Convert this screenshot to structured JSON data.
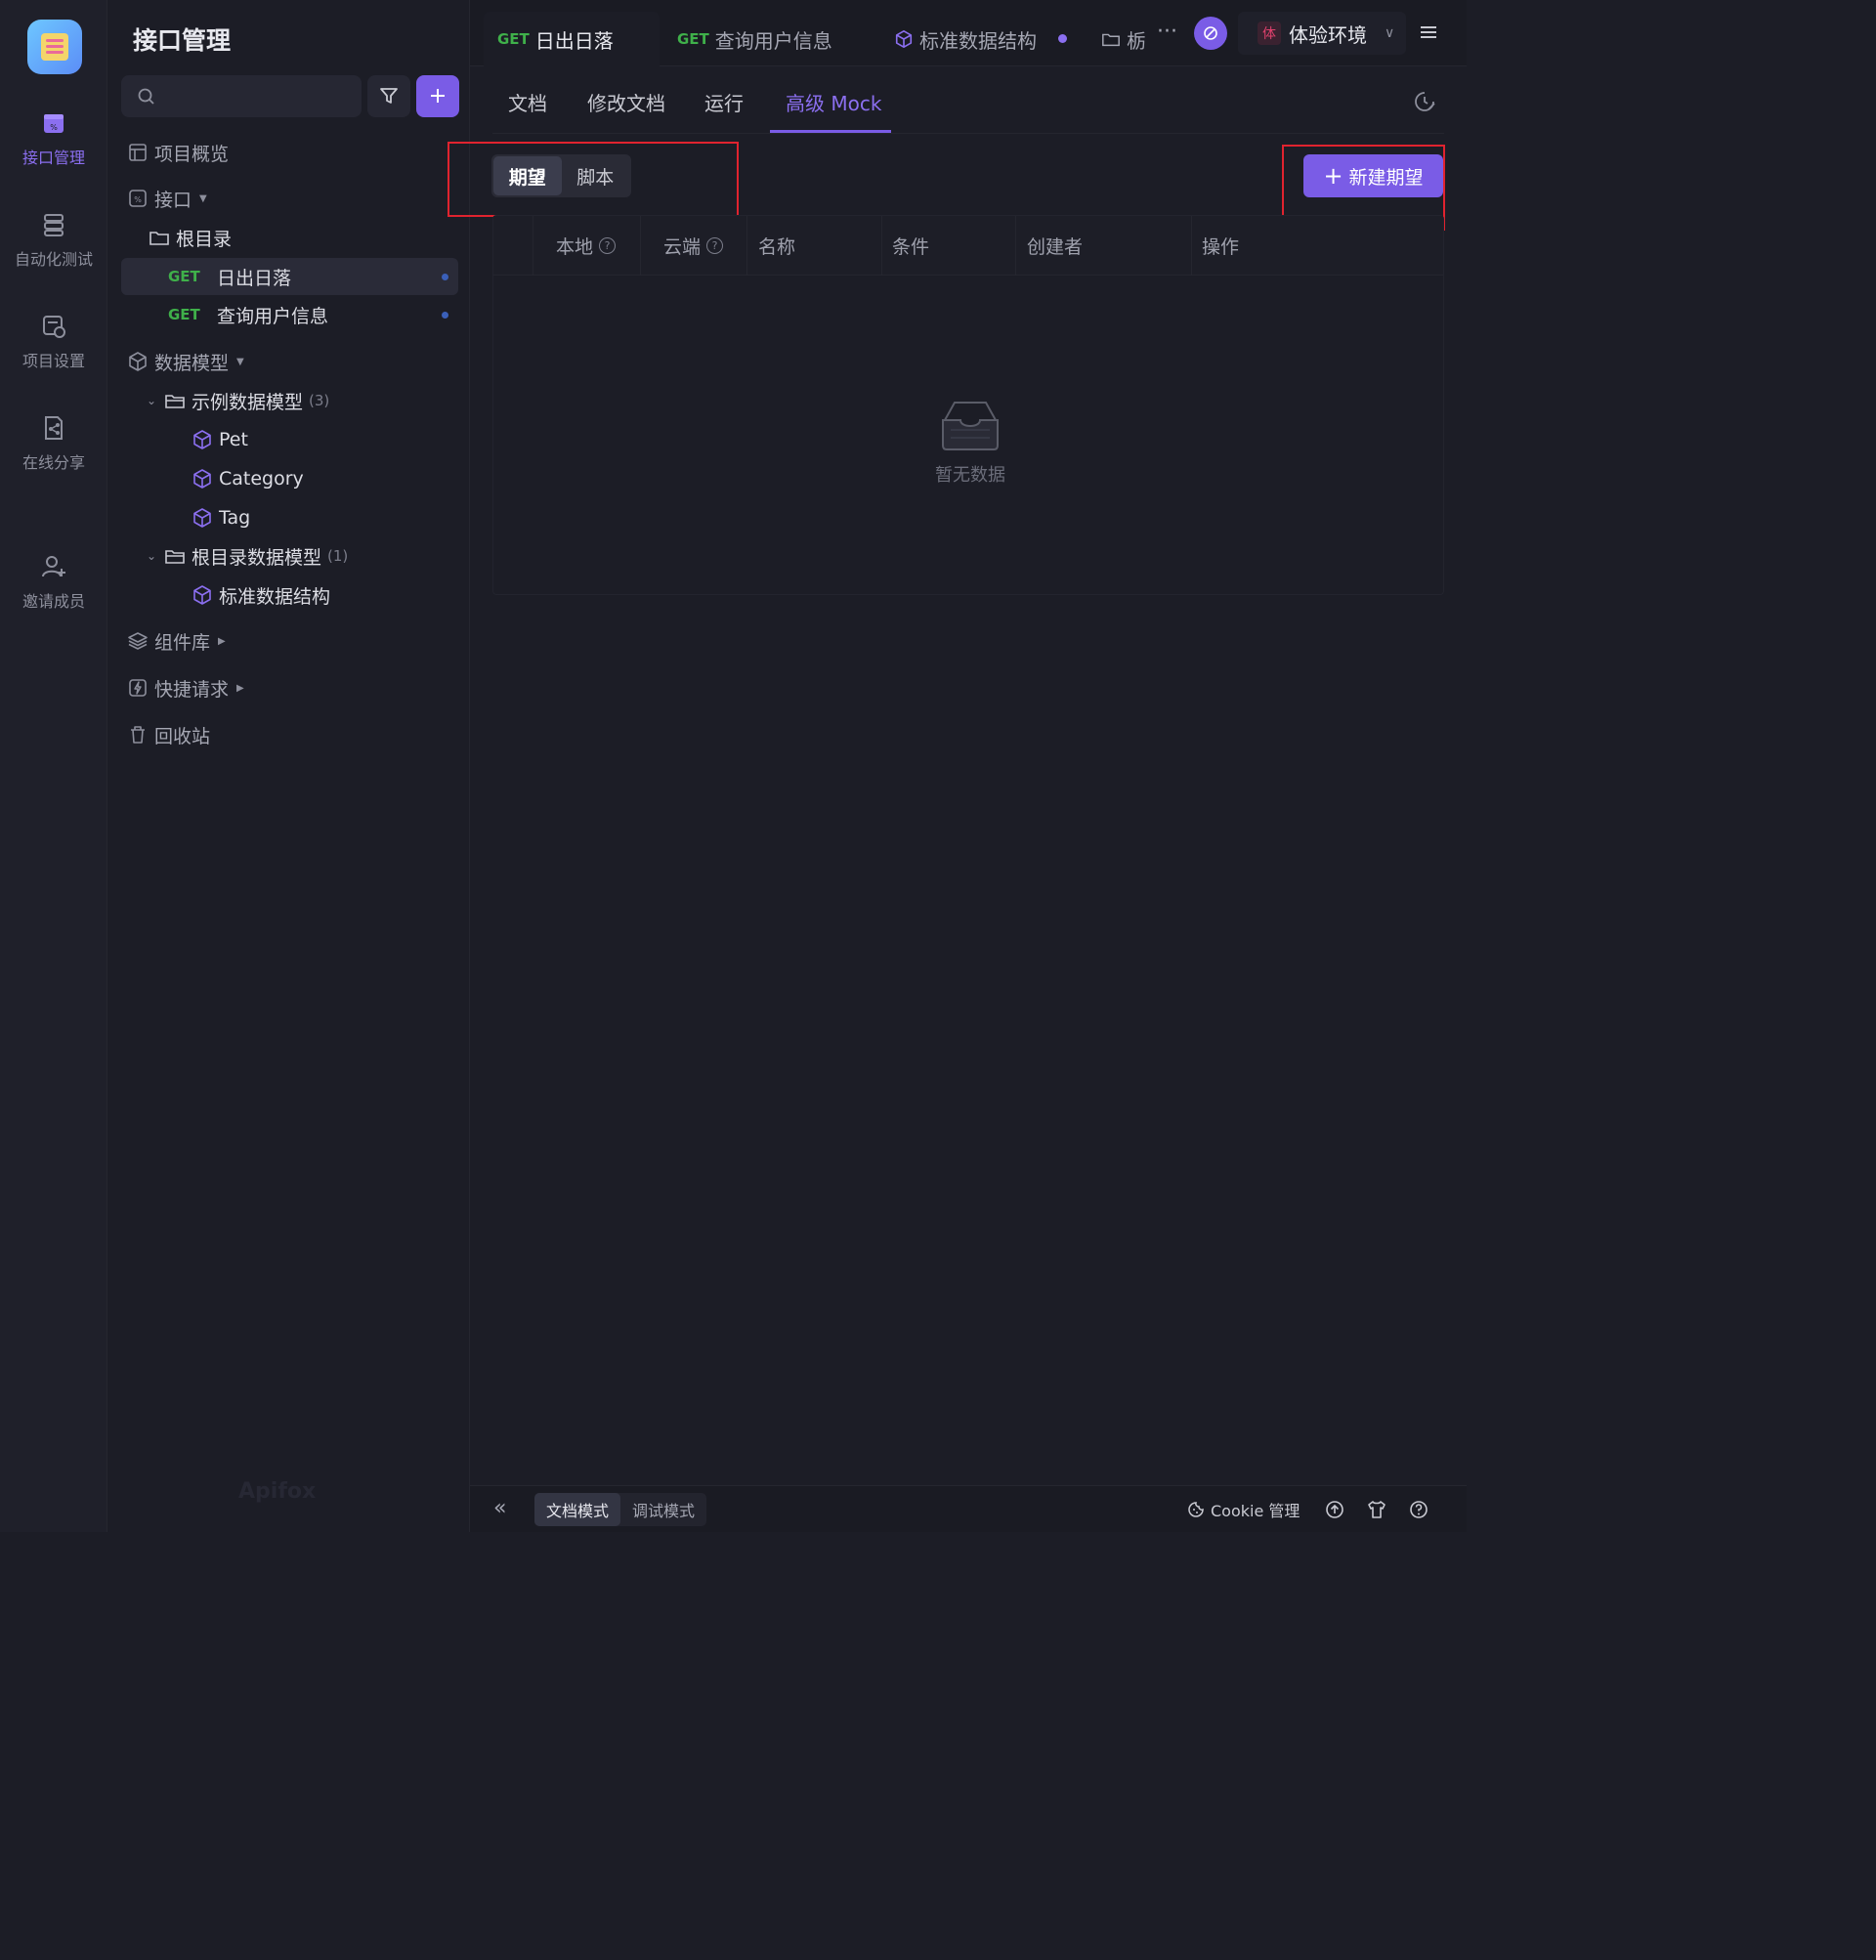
{
  "app": {
    "rail": [
      {
        "label": "接口管理",
        "icon": "api-icon",
        "active": true
      },
      {
        "label": "自动化测试",
        "icon": "database-icon",
        "active": false
      },
      {
        "label": "项目设置",
        "icon": "project-settings-icon",
        "active": false
      },
      {
        "label": "在线分享",
        "icon": "share-doc-icon",
        "active": false
      },
      {
        "label": "邀请成员",
        "icon": "invite-user-icon",
        "active": false
      }
    ],
    "watermark": "Apifox"
  },
  "sidebar": {
    "title": "接口管理",
    "search": {
      "value": "",
      "placeholder": ""
    },
    "tree": {
      "overview": "项目概览",
      "apis": "接口",
      "root": "根目录",
      "endpoints": [
        {
          "method": "GET",
          "name": "日出日落",
          "selected": true
        },
        {
          "method": "GET",
          "name": "查询用户信息",
          "selected": false
        }
      ],
      "models": "数据模型",
      "example_folder": {
        "name": "示例数据模型",
        "count": "(3)",
        "items": [
          "Pet",
          "Category",
          "Tag"
        ]
      },
      "root_folder": {
        "name": "根目录数据模型",
        "count": "(1)",
        "items": [
          "标准数据结构"
        ]
      },
      "components": "组件库",
      "quick": "快捷请求",
      "trash": "回收站"
    }
  },
  "tabs": [
    {
      "method": "GET",
      "name": "日出日落",
      "active": true
    },
    {
      "method": "GET",
      "name": "查询用户信息",
      "active": false
    },
    {
      "method": "",
      "name": "标准数据结构",
      "active": false
    },
    {
      "method": "",
      "name": "栃",
      "active": false
    }
  ],
  "env": {
    "badge": "体",
    "name": "体验环境"
  },
  "subtabs": [
    "文档",
    "修改文档",
    "运行",
    "高级 Mock"
  ],
  "active_subtab": "高级 Mock",
  "segment": {
    "options": [
      "期望",
      "脚本"
    ],
    "selected": "期望"
  },
  "new_button": "新建期望",
  "table": {
    "columns": [
      "本地",
      "云端",
      "名称",
      "条件",
      "创建者",
      "操作"
    ],
    "help_mark": "?",
    "empty_text": "暂无数据"
  },
  "statusbar": {
    "modes": [
      "文档模式",
      "调试模式"
    ],
    "selected_mode": "文档模式",
    "cookie": "Cookie 管理"
  },
  "colors": {
    "accent": "#7a5ce6",
    "get": "#3fb04a",
    "highlight_box": "#e0232f"
  }
}
